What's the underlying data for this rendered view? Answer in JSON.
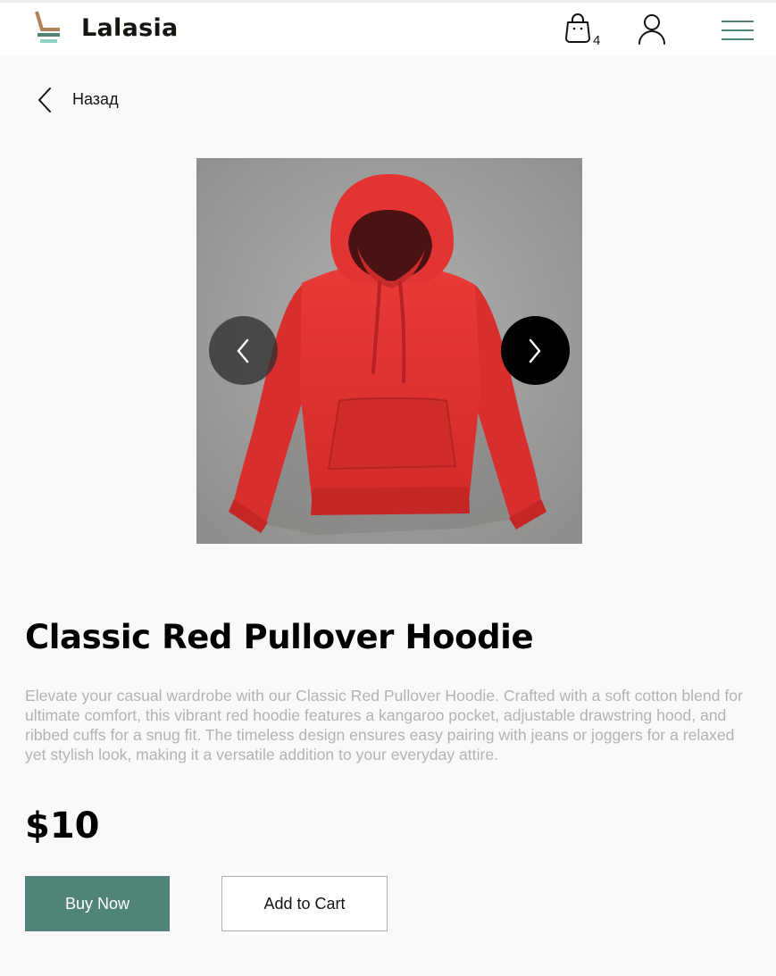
{
  "header": {
    "brand": "Lalasia",
    "cart_count": "4",
    "icons": {
      "logo": "chair-logo-icon",
      "cart": "shopping-bag-icon",
      "user": "user-icon",
      "menu": "hamburger-menu-icon"
    }
  },
  "back": {
    "label": "Назад",
    "icon": "chevron-left-icon"
  },
  "product": {
    "image_alt": "red-hoodie-photo",
    "title": "Classic Red Pullover Hoodie",
    "description": "Elevate your casual wardrobe with our Classic Red Pullover Hoodie. Crafted with a soft cotton blend for ultimate comfort, this vibrant red hoodie features a kangaroo pocket, adjustable drawstring hood, and ribbed cuffs for a snug fit. The timeless design ensures easy pairing with jeans or joggers for a relaxed yet stylish look, making it a versatile addition to your everyday attire.",
    "price": "$10"
  },
  "actions": {
    "buy_label": "Buy Now",
    "cart_label": "Add to Cart"
  },
  "colors": {
    "accent": "#518479",
    "background": "#f9f9f9",
    "text_muted": "#b3b3b3",
    "hoodie": "#e63434"
  }
}
